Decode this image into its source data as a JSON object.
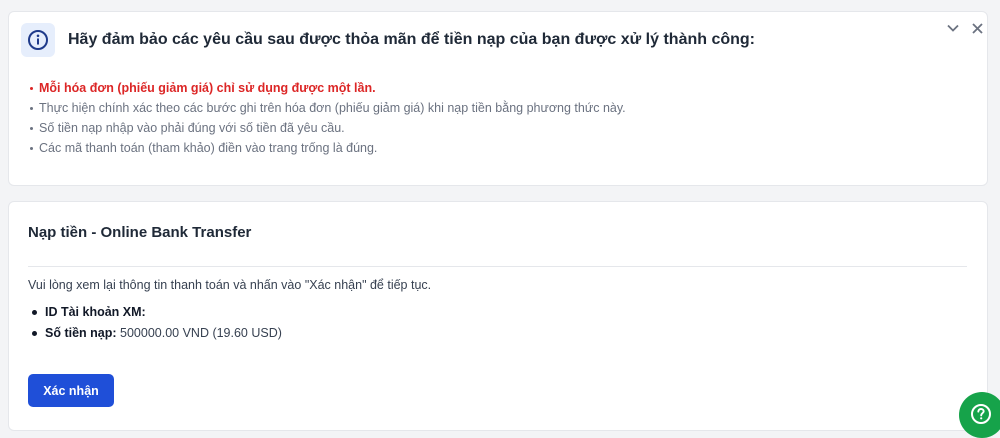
{
  "notice": {
    "title": "Hãy đảm bảo các yêu cầu sau được thỏa mãn để tiền nạp của bạn được xử lý thành công:",
    "items": [
      "Mỗi hóa đơn (phiếu giảm giá) chỉ sử dụng được một lần.",
      "Thực hiện chính xác theo các bước ghi trên hóa đơn (phiếu giảm giá) khi nạp tiền bằng phương thức này.",
      "Số tiền nạp nhập vào phải đúng với số tiền đã yêu cầu.",
      "Các mã thanh toán (tham khảo) điền vào trang trống là đúng."
    ],
    "icon": "info-icon",
    "collapse_icon": "chevron-down-icon",
    "close_icon": "close-icon"
  },
  "deposit": {
    "title": "Nạp tiền - Online Bank Transfer",
    "intro": "Vui lòng xem lại thông tin thanh toán và nhấn vào \"Xác nhận\" để tiếp tục.",
    "account_label": "ID Tài khoản XM:",
    "account_value": "",
    "amount_label": "Số tiền nạp:",
    "amount_value": "500000.00 VND (19.60 USD)",
    "confirm_label": "Xác nhận"
  },
  "help": {
    "icon": "help-icon"
  },
  "colors": {
    "accent": "#1f4fd8",
    "warning": "#dc2626",
    "help": "#16a34a"
  }
}
